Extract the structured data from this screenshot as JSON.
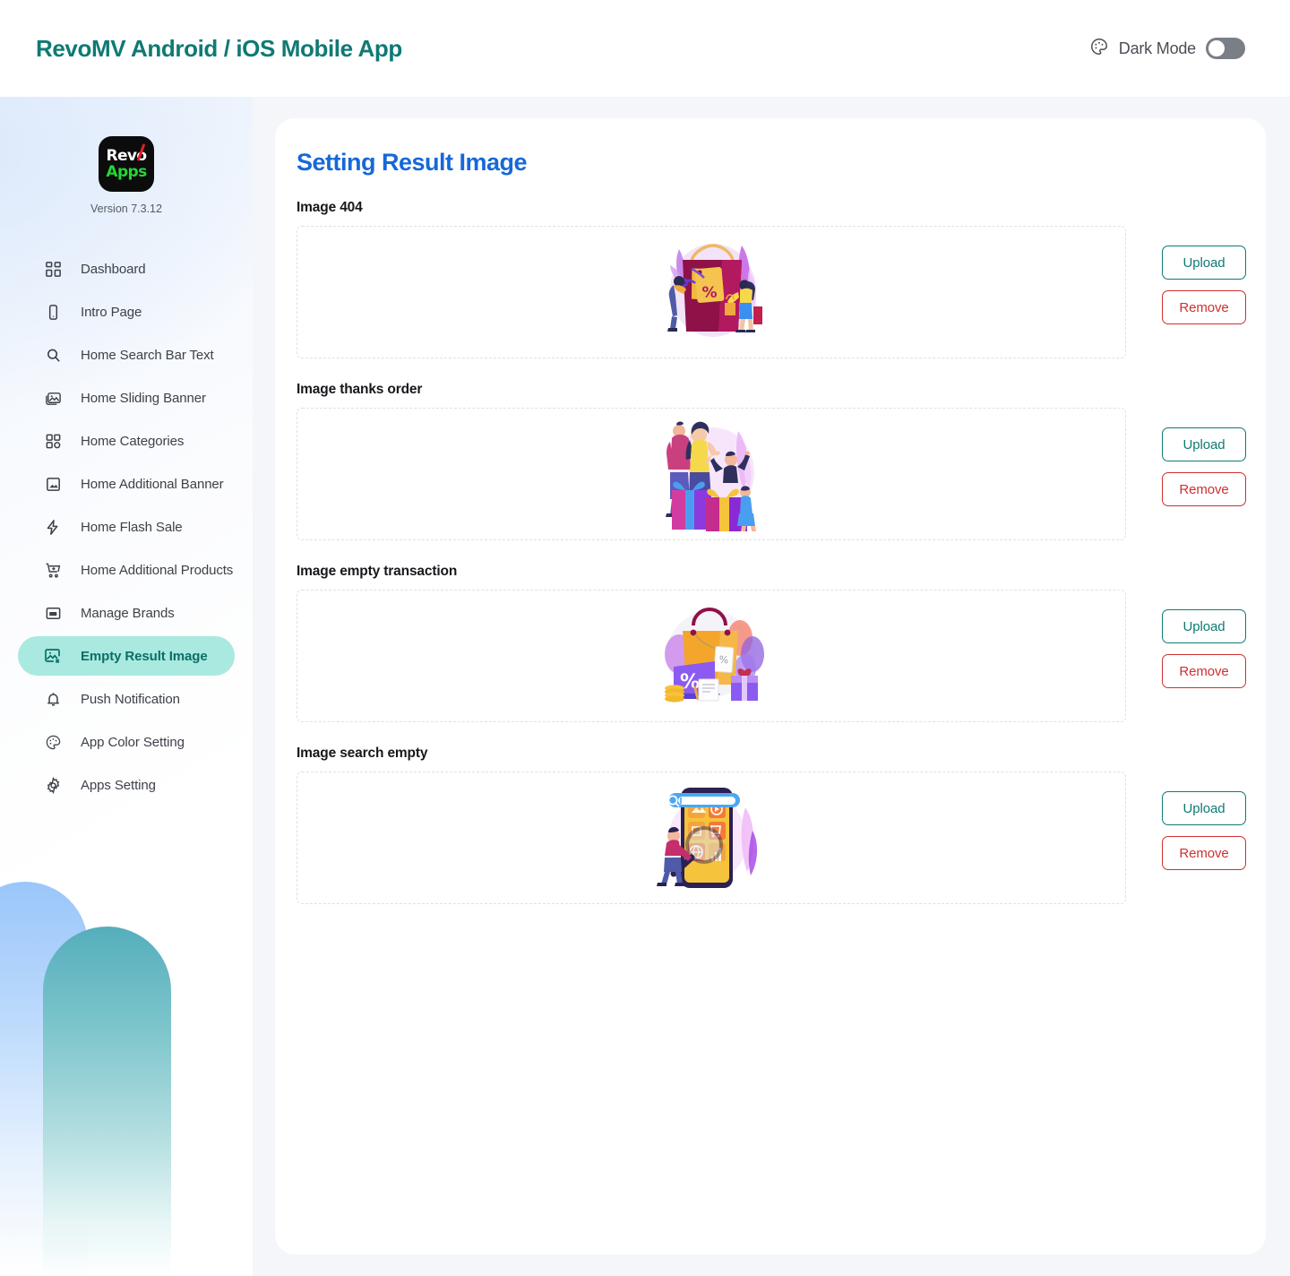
{
  "header": {
    "title": "RevoMV Android / iOS Mobile App",
    "dark_mode_label": "Dark Mode",
    "dark_mode_enabled": false,
    "palette_icon": "palette-icon",
    "title_color": "#0f7a74"
  },
  "sidebar": {
    "logo": {
      "line1": "Revo",
      "line2": "Apps"
    },
    "version": "Version 7.3.12",
    "active_item": "Empty Result Image",
    "active_bg": "#a9e9e0",
    "active_fg": "#0b6e67",
    "items": [
      {
        "label": "Dashboard",
        "icon": "dashboard-grid-icon",
        "active": false
      },
      {
        "label": "Intro Page",
        "icon": "mobile-phone-icon",
        "active": false
      },
      {
        "label": "Home Search Bar Text",
        "icon": "search-icon",
        "active": false
      },
      {
        "label": "Home Sliding Banner",
        "icon": "images-stack-icon",
        "active": false
      },
      {
        "label": "Home Categories",
        "icon": "categories-grid-icon",
        "active": false
      },
      {
        "label": "Home Additional Banner",
        "icon": "banner-image-icon",
        "active": false
      },
      {
        "label": "Home Flash Sale",
        "icon": "lightning-bolt-icon",
        "active": false
      },
      {
        "label": "Home Additional Products",
        "icon": "cart-plus-icon",
        "active": false
      },
      {
        "label": "Manage Brands",
        "icon": "brand-card-icon",
        "active": false
      },
      {
        "label": "Empty Result Image",
        "icon": "image-x-icon",
        "active": true
      },
      {
        "label": "Push Notification",
        "icon": "bell-icon",
        "active": false
      },
      {
        "label": "App Color Setting",
        "icon": "palette-icon",
        "active": false
      },
      {
        "label": "Apps Setting",
        "icon": "gear-icon",
        "active": false
      }
    ]
  },
  "main": {
    "page_title": "Setting Result Image",
    "page_title_color": "#1668d8",
    "upload_label": "Upload",
    "remove_label": "Remove",
    "upload_color": "#0f7a74",
    "remove_color": "#cf3030",
    "sections": [
      {
        "label": "Image 404",
        "illustration": "shopping-bag-discount-tag-illustration"
      },
      {
        "label": "Image thanks order",
        "illustration": "family-with-gift-boxes-illustration"
      },
      {
        "label": "Image empty transaction",
        "illustration": "shopping-bag-coins-gift-illustration"
      },
      {
        "label": "Image search empty",
        "illustration": "phone-search-magnifier-illustration"
      }
    ]
  }
}
